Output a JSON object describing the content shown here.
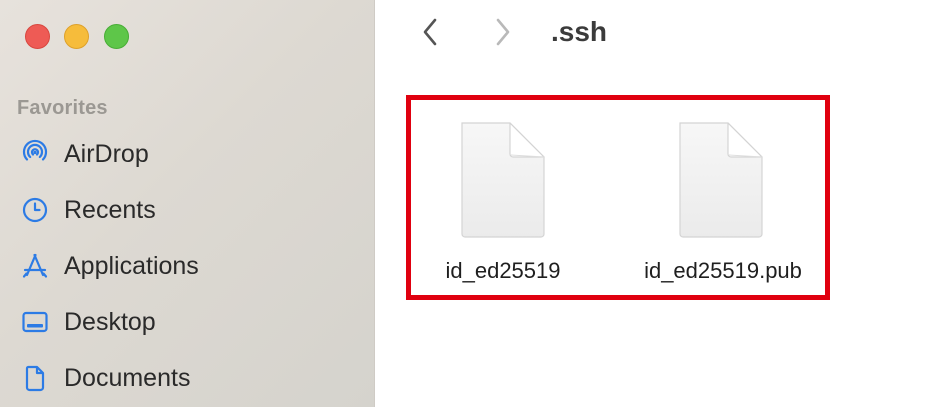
{
  "window": {
    "title": ".ssh"
  },
  "sidebar": {
    "section_title": "Favorites",
    "items": [
      {
        "label": "AirDrop",
        "icon": "airdrop-icon"
      },
      {
        "label": "Recents",
        "icon": "clock-icon"
      },
      {
        "label": "Applications",
        "icon": "applications-icon"
      },
      {
        "label": "Desktop",
        "icon": "desktop-icon"
      },
      {
        "label": "Documents",
        "icon": "document-icon"
      }
    ]
  },
  "toolbar": {
    "back_icon": "chevron-left-icon",
    "forward_icon": "chevron-right-icon"
  },
  "files": [
    {
      "name": "id_ed25519",
      "icon": "generic-file-icon"
    },
    {
      "name": "id_ed25519.pub",
      "icon": "generic-file-icon"
    }
  ],
  "colors": {
    "accent_blue": "#2c7be5",
    "highlight_red": "#e0000f",
    "close": "#ee5b55",
    "minimize": "#f6bc3b",
    "zoom": "#5ec649"
  }
}
